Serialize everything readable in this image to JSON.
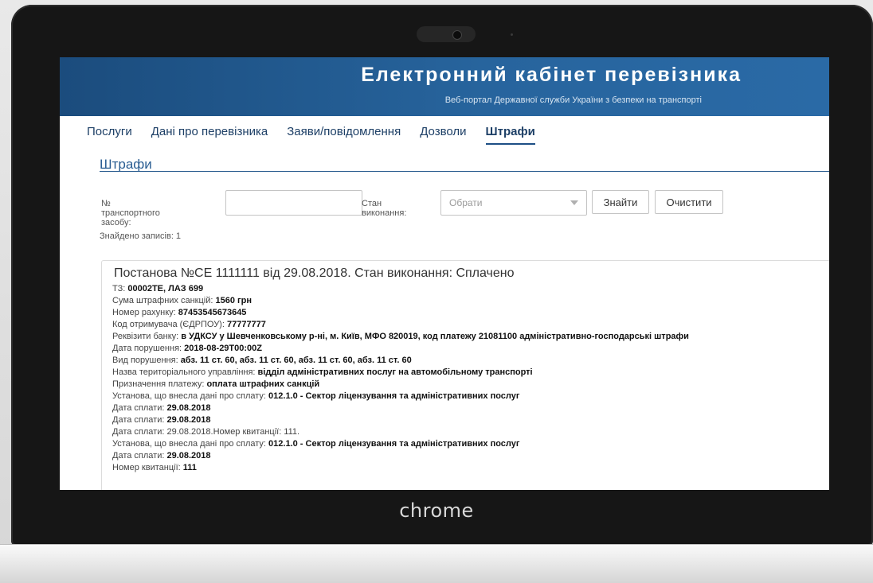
{
  "device": {
    "brand": "chrome"
  },
  "banner": {
    "title": "Електронний кабінет перевізника",
    "subtitle": "Веб-портал Державної служби України з безпеки на транспорті"
  },
  "nav": {
    "items": [
      {
        "label": "Послуги"
      },
      {
        "label": "Дані про перевізника"
      },
      {
        "label": "Заяви/повідомлення"
      },
      {
        "label": "Дозволи"
      },
      {
        "label": "Штрафи",
        "active": true
      }
    ]
  },
  "section": {
    "title": "Штрафи"
  },
  "filters": {
    "plate_label": "№ транспортного засобу:",
    "plate_value": "",
    "status_label": "Стан виконання:",
    "status_placeholder": "Обрати",
    "find_label": "Знайти",
    "clear_label": "Очистити"
  },
  "results": {
    "found_text": "Знайдено записів: 1"
  },
  "record": {
    "title": "Постанова №СЕ 1111111 від 29.08.2018. Стан виконання: Сплачено",
    "lines": [
      {
        "label": "ТЗ: ",
        "value": "00002ТЕ, ЛАЗ 699"
      },
      {
        "label": "Сума штрафних санкцій: ",
        "value": "1560 грн"
      },
      {
        "label": "Номер рахунку: ",
        "value": "87453545673645"
      },
      {
        "label": "Код отримувача (ЄДРПОУ): ",
        "value": "77777777"
      },
      {
        "label": "Реквізити банку: ",
        "value": "в УДКСУ у Шевченковському р-ні, м. Київ, МФО 820019, код платежу 21081100 адміністративно-господарські штрафи"
      },
      {
        "label": "Дата порушення: ",
        "value": "2018-08-29T00:00Z"
      },
      {
        "label": "Вид порушення: ",
        "value": "абз. 11 ст. 60, абз. 11 ст. 60, абз. 11 ст. 60, абз. 11 ст. 60"
      },
      {
        "label": "Назва територіального управління: ",
        "value": "відділ адміністративних послуг на автомобільному транспорті"
      },
      {
        "label": "Призначення платежу: ",
        "value": "оплата штрафних санкцій"
      },
      {
        "label": "Установа, що внесла дані про сплату: ",
        "value": "012.1.0 - Сектор ліцензування та адміністративних послуг"
      },
      {
        "label": "Дата сплати: ",
        "value": "29.08.2018"
      },
      {
        "label": "Дата сплати: ",
        "value": "29.08.2018"
      },
      {
        "label": "Дата сплати: 29.08.2018.Номер квитанції: 111.",
        "value": ""
      },
      {
        "label": "Установа, що внесла дані про сплату: ",
        "value": "012.1.0 - Сектор ліцензування та адміністративних послуг"
      },
      {
        "label": "Дата сплати: ",
        "value": "29.08.2018"
      },
      {
        "label": "Номер квитанції: ",
        "value": "111"
      }
    ]
  }
}
